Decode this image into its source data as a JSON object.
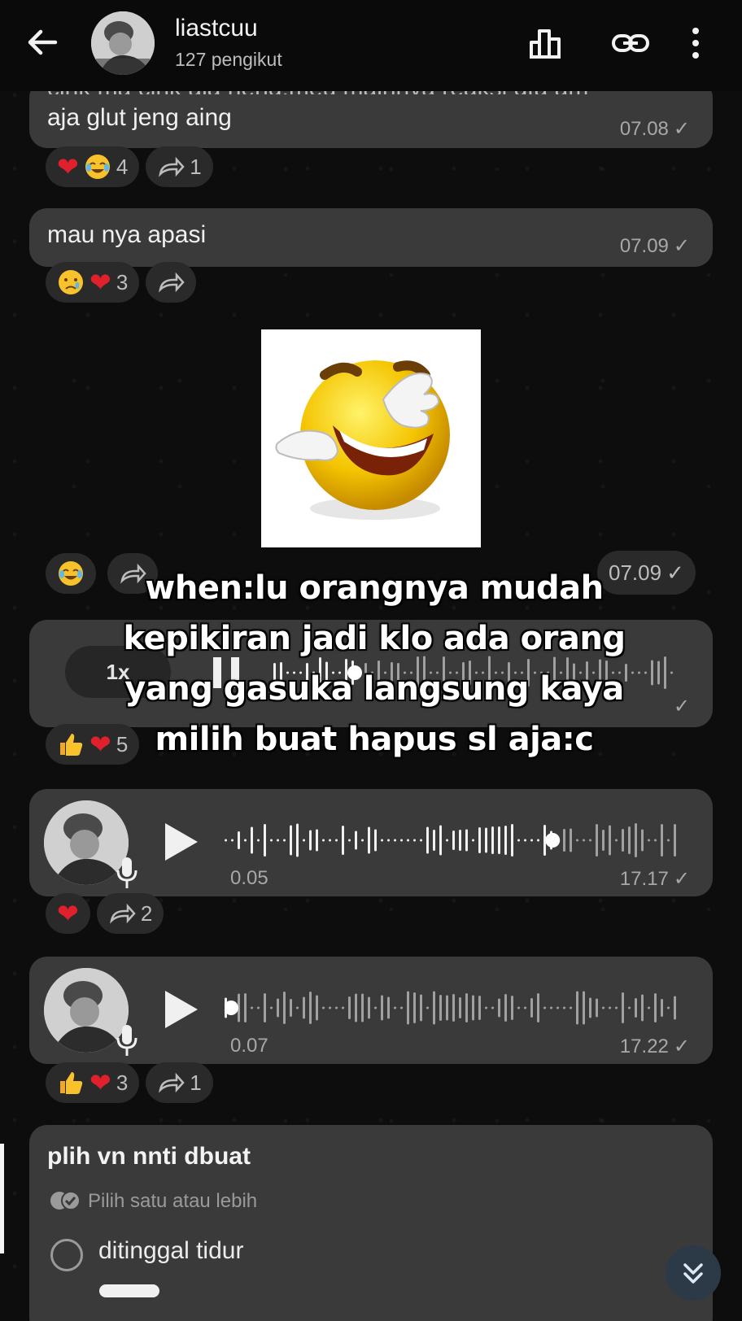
{
  "header": {
    "name": "liastcuu",
    "followers": "127 pengikut"
  },
  "messages": [
    {
      "partial_text": "cink ma cink aja heng,meu mainnya reaksi gta am",
      "text": "aja glut jeng aing",
      "time": "07.08",
      "reactions": [
        {
          "icon": "heart",
          "count": ""
        },
        {
          "icon": "tears-of-joy",
          "count": "4"
        }
      ],
      "forward_count": "1"
    },
    {
      "text": "mau nya apasi",
      "time": "07.09",
      "reactions": [
        {
          "icon": "crying-face",
          "count": ""
        },
        {
          "icon": "heart",
          "count": "3"
        }
      ],
      "forward_count": ""
    },
    {
      "type": "sticker",
      "sticker_name": "laughing-face-sticker",
      "time": "07.09",
      "reactions": [
        {
          "icon": "tears-of-joy",
          "count": ""
        }
      ],
      "forward_count": ""
    },
    {
      "type": "voice-playing",
      "speed": "1x",
      "reactions": [
        {
          "icon": "thumbs-up",
          "count": ""
        },
        {
          "icon": "heart",
          "count": "5"
        }
      ]
    },
    {
      "type": "voice",
      "duration": "0.05",
      "time": "17.17",
      "progress": 0.72,
      "reactions": [
        {
          "icon": "heart",
          "count": ""
        }
      ],
      "forward_count": "2"
    },
    {
      "type": "voice",
      "duration": "0.07",
      "time": "17.22",
      "progress": 0.0,
      "reactions": [
        {
          "icon": "thumbs-up",
          "count": ""
        },
        {
          "icon": "heart",
          "count": "3"
        }
      ],
      "forward_count": "1"
    }
  ],
  "poll": {
    "title": "plih vn nnti dbuat",
    "subtitle": "Pilih satu atau lebih",
    "options": [
      "ditinggal tidur"
    ]
  },
  "caption": {
    "line1": "when:lu orangnya mudah",
    "line2": "kepikiran jadi klo ada orang",
    "line3": "yang gasuka langsung kaya",
    "line4": "milih buat hapus sl aja:c"
  },
  "colors": {
    "bubble": "#3a3a3a",
    "heart": "#e0202c",
    "background": "#0c0c0c"
  }
}
